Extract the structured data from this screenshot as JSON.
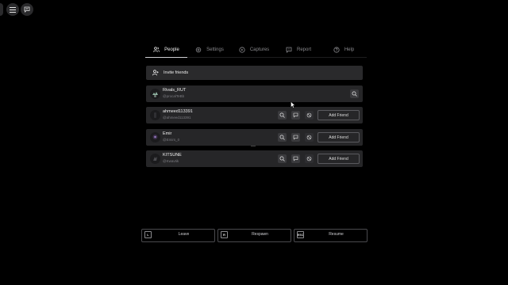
{
  "tabs": [
    {
      "label": "People",
      "icon": "people-icon",
      "active": true
    },
    {
      "label": "Settings",
      "icon": "gear-icon",
      "active": false
    },
    {
      "label": "Captures",
      "icon": "play-icon",
      "active": false
    },
    {
      "label": "Report",
      "icon": "report-icon",
      "active": false
    },
    {
      "label": "Help",
      "icon": "help-icon",
      "active": false
    }
  ],
  "invite": {
    "label": "Invite friends",
    "icon": "add-user-icon"
  },
  "players": [
    {
      "name": "Rivals_RUT",
      "tag": "@procalTeBb",
      "is_self": true
    },
    {
      "name": "ahmeed113391",
      "tag": "@ahmeed113391",
      "button": "Add Friend"
    },
    {
      "name": "Emir",
      "tag": "@Emirs_0",
      "button": "Add Friend"
    },
    {
      "name": "KITSUNE",
      "tag": "@Kwavtik",
      "button": "Add Friend"
    }
  ],
  "actions": [
    {
      "key": "L",
      "label": "Leave"
    },
    {
      "key": "R",
      "label": "Respawn"
    },
    {
      "key": "ESC",
      "label": "Resume"
    }
  ],
  "colors": {
    "background": "#000000",
    "panel": "#262628",
    "button": "#3a3a3d",
    "text": "#e6e6e6",
    "muted": "#8a8a8e"
  }
}
